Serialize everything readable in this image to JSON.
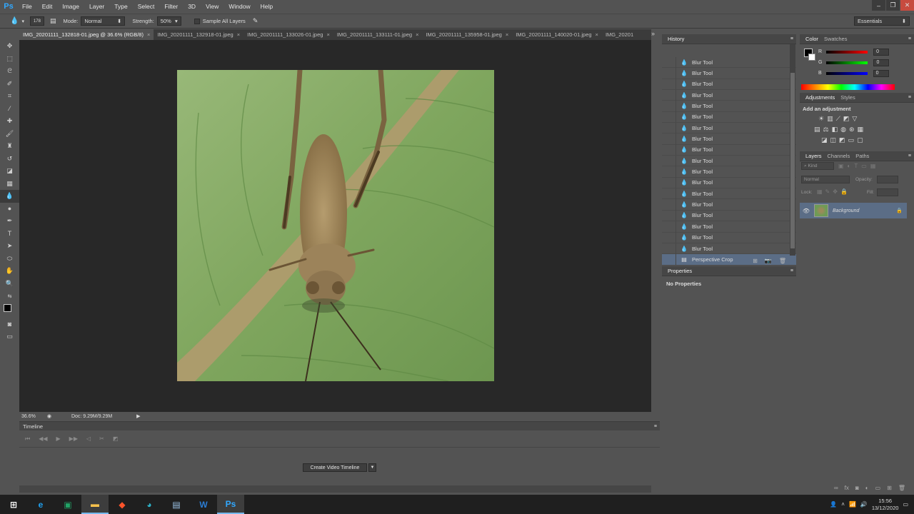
{
  "app": {
    "logo": "Ps"
  },
  "menu": [
    "File",
    "Edit",
    "Image",
    "Layer",
    "Type",
    "Select",
    "Filter",
    "3D",
    "View",
    "Window",
    "Help"
  ],
  "options": {
    "brush_size": "178",
    "mode_label": "Mode:",
    "mode_value": "Normal",
    "strength_label": "Strength:",
    "strength_value": "50%",
    "sample_all": "Sample All Layers",
    "workspace": "Essentials"
  },
  "tabs": [
    "IMG_20201111_132818-01.jpeg @ 36.6% (RGB/8)",
    "IMG_20201111_132918-01.jpeg",
    "IMG_20201111_133026-01.jpeg",
    "IMG_20201111_133111-01.jpeg",
    "IMG_20201111_135958-01.jpeg",
    "IMG_20201111_140020-01.jpeg",
    "IMG_20201"
  ],
  "status": {
    "zoom": "36.6%",
    "doc": "Doc: 9.29M/9.29M"
  },
  "timeline": {
    "title": "Timeline",
    "create_button": "Create Video Timeline"
  },
  "history": {
    "title": "History",
    "items": [
      "Blur Tool",
      "Blur Tool",
      "Blur Tool",
      "Blur Tool",
      "Blur Tool",
      "Blur Tool",
      "Blur Tool",
      "Blur Tool",
      "Blur Tool",
      "Blur Tool",
      "Blur Tool",
      "Blur Tool",
      "Blur Tool",
      "Blur Tool",
      "Blur Tool",
      "Blur Tool",
      "Blur Tool",
      "Blur Tool"
    ],
    "selected_item": "Perspective Crop"
  },
  "properties": {
    "title": "Properties",
    "empty": "No Properties"
  },
  "color": {
    "tab_color": "Color",
    "tab_swatches": "Swatches",
    "r": "0",
    "g": "0",
    "b": "0",
    "r_label": "R",
    "g_label": "G",
    "b_label": "B"
  },
  "adjustments": {
    "tab_adj": "Adjustments",
    "tab_styles": "Styles",
    "heading": "Add an adjustment"
  },
  "layers": {
    "tab_layers": "Layers",
    "tab_channels": "Channels",
    "tab_paths": "Paths",
    "kind": "Kind",
    "blend": "Normal",
    "opacity_label": "Opacity:",
    "lock_label": "Lock:",
    "fill_label": "Fill:",
    "layer_name": "Background"
  },
  "taskbar": {
    "time": "15:56",
    "date": "13/12/2020"
  },
  "colors": {
    "accent": "#5b6d86",
    "canvas_bg": "#282828",
    "panel_bg": "#535353"
  }
}
